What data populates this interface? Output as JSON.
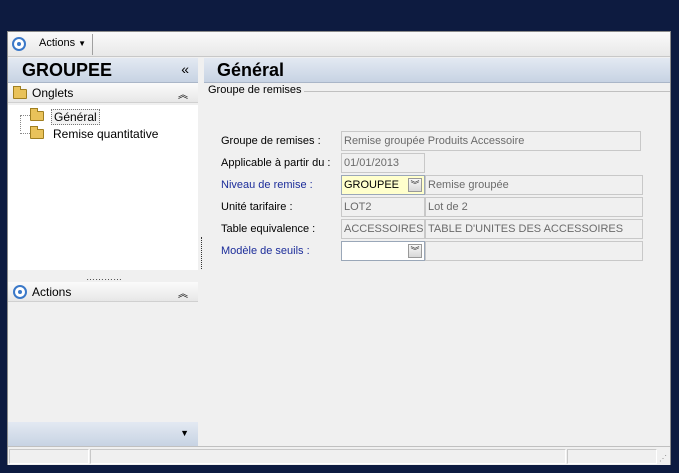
{
  "toolbar": {
    "actions_label": "Actions",
    "actions_icon": "target-icon"
  },
  "left_pane": {
    "title": "GROUPEE",
    "collapse_glyph": "«",
    "tabs_header": "Onglets",
    "tree": [
      {
        "label": "Général",
        "selected": true
      },
      {
        "label": "Remise quantitative",
        "selected": false
      }
    ],
    "actions_header": "Actions",
    "chevron_up": "˄",
    "chevron_down": "▾",
    "splitter_dots": "…………"
  },
  "right_pane": {
    "title": "Général",
    "group_legend": "Groupe de remises",
    "fields": {
      "groupe_remises": {
        "label": "Groupe de remises :",
        "value": "Remise groupée Produits Accessoire"
      },
      "applicable": {
        "label": "Applicable à partir du :",
        "value": "01/01/2013"
      },
      "niveau": {
        "label": "Niveau de remise :",
        "code": "GROUPEE",
        "desc": "Remise groupée"
      },
      "unite": {
        "label": "Unité tarifaire :",
        "code": "LOT2",
        "desc": "Lot de 2"
      },
      "table": {
        "label": "Table equivalence :",
        "code": "ACCESSOIRES",
        "desc": "TABLE D'UNITES DES ACCESSOIRES"
      },
      "modele": {
        "label": "Modèle de seuils :",
        "code": "",
        "desc": ""
      }
    }
  },
  "statusbar": {
    "grip": "⋰"
  },
  "colors": {
    "background": "#0d1b40",
    "title_bar": "#c7d3e3",
    "link_label": "#1c2d9a",
    "highlight_field": "#ffffcc"
  }
}
